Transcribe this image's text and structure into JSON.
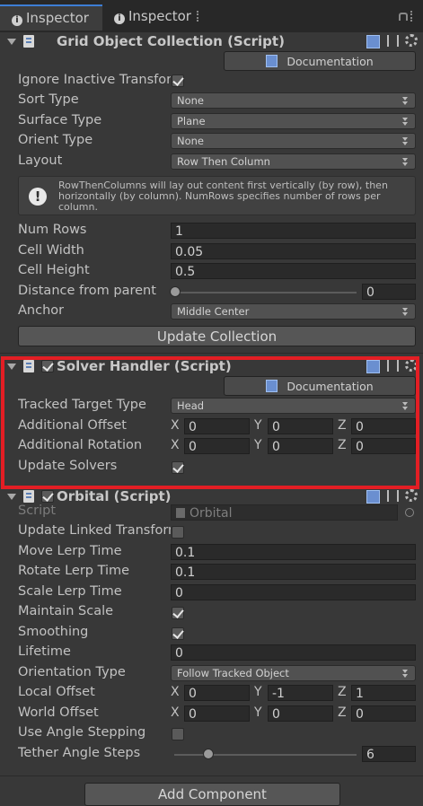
{
  "tabs": [
    {
      "label": "Inspector"
    },
    {
      "label": "Inspector"
    }
  ],
  "grid": {
    "title": "Grid Object Collection (Script)",
    "doc_label": "Documentation",
    "ignore_label": "Ignore Inactive Transfor",
    "ignore_checked": true,
    "sort_label": "Sort Type",
    "sort_value": "None",
    "surface_label": "Surface Type",
    "surface_value": "Plane",
    "orient_label": "Orient Type",
    "orient_value": "None",
    "layout_label": "Layout",
    "layout_value": "Row Then Column",
    "help_text": "RowThenColumns will lay out content first vertically (by row), then horizontally (by column). NumRows specifies number of rows per column.",
    "numrows_label": "Num Rows",
    "numrows_value": "1",
    "cellwidth_label": "Cell Width",
    "cellwidth_value": "0.05",
    "cellheight_label": "Cell Height",
    "cellheight_value": "0.5",
    "distance_label": "Distance from parent",
    "distance_value": "0",
    "anchor_label": "Anchor",
    "anchor_value": "Middle Center",
    "update_button": "Update Collection"
  },
  "solver": {
    "title": "Solver Handler (Script)",
    "enabled": true,
    "doc_label": "Documentation",
    "tracked_label": "Tracked Target Type",
    "tracked_value": "Head",
    "offset_label": "Additional Offset",
    "offset": {
      "x": "0",
      "y": "0",
      "z": "0"
    },
    "rotation_label": "Additional Rotation",
    "rotation": {
      "x": "0",
      "y": "0",
      "z": "0"
    },
    "update_label": "Update Solvers",
    "update_checked": true
  },
  "orbital": {
    "title": "Orbital (Script)",
    "enabled": true,
    "script_label": "Script",
    "script_value": "Orbital",
    "linked_label": "Update Linked Transform",
    "linked_checked": false,
    "move_label": "Move Lerp Time",
    "move_value": "0.1",
    "rotate_label": "Rotate Lerp Time",
    "rotate_value": "0.1",
    "scale_label": "Scale Lerp Time",
    "scale_value": "0",
    "maintain_label": "Maintain Scale",
    "maintain_checked": true,
    "smoothing_label": "Smoothing",
    "smoothing_checked": true,
    "lifetime_label": "Lifetime",
    "lifetime_value": "0",
    "orientation_label": "Orientation Type",
    "orientation_value": "Follow Tracked Object",
    "local_label": "Local Offset",
    "local": {
      "x": "0",
      "y": "-1",
      "z": "1"
    },
    "world_label": "World Offset",
    "world": {
      "x": "0",
      "y": "0",
      "z": "0"
    },
    "angle_label": "Use Angle Stepping",
    "angle_checked": false,
    "tether_label": "Tether Angle Steps",
    "tether_value": "6"
  },
  "add_component": "Add Component",
  "axes": {
    "x": "X",
    "y": "Y",
    "z": "Z"
  },
  "colors": {
    "highlight": "#e31e24",
    "accent": "#3d7ed5"
  }
}
